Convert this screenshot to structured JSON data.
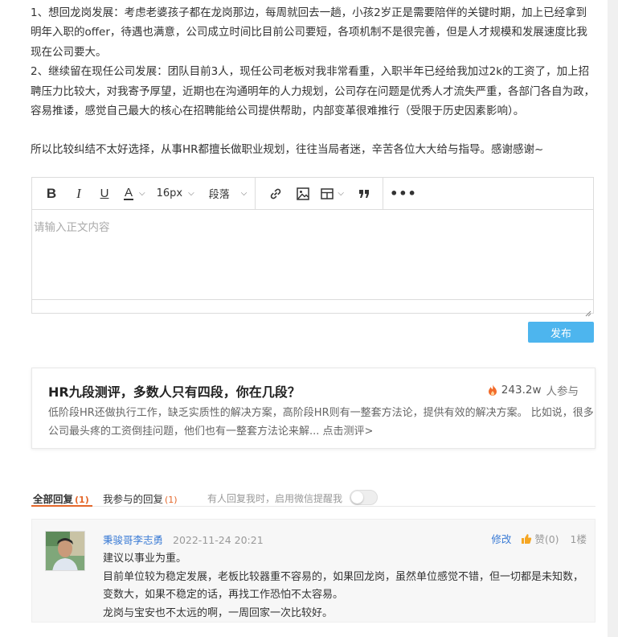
{
  "post": {
    "paragraphs": [
      "1、想回龙岗发展：考虑老婆孩子都在龙岗那边，每周就回去一趟，小孩2岁正是需要陪伴的关键时期，加上已经拿到明年入职的offer，待遇也满意，公司成立时间比目前公司要短，各项机制不是很完善，但是人才规模和发展速度比我现在公司要大。",
      "2、继续留在现任公司发展：团队目前3人，现任公司老板对我非常看重，入职半年已经给我加过2k的工资了，加上招聘压力比较大，对我寄予厚望，近期也在沟通明年的人力规划，公司存在问题是优秀人才流失严重，各部门各自为政，容易推诿，感觉自己最大的核心在招聘能给公司提供帮助，内部变革很难推行（受限于历史因素影响）。",
      "所以比较纠结不太好选择，从事HR都擅长做职业规划，往往当局者迷，辛苦各位大大给与指导。感谢感谢~"
    ]
  },
  "editor": {
    "font_size": "16px",
    "paragraph_style": "段落",
    "placeholder": "请输入正文内容",
    "icons": [
      "bold-icon",
      "italic-icon",
      "underline-icon",
      "font-color-icon",
      "link-icon",
      "image-icon",
      "table-icon",
      "quote-icon",
      "more-icon"
    ]
  },
  "publish_label": "发布",
  "promo": {
    "title": "HR九段测评，多数人只有四段，你在几段？",
    "count": "243.2w",
    "count_label": "人参与",
    "description": "低阶段HR还做执行工作，缺乏实质性的解决方案，高阶段HR则有一整套方法论，提供有效的解决方案。 比如说，很多公司最头疼的工资倒挂问题，他们也有一整套方法论来解... 点击测评>"
  },
  "tabs": {
    "all_label": "全部回复",
    "all_count": "(1)",
    "mine_label": "我参与的回复",
    "mine_count": "(1)",
    "notify_text": "有人回复我时，启用微信提醒我"
  },
  "reply": {
    "author": "秉骏哥李志勇",
    "time": "2022-11-24 20:21",
    "edit_label": "修改",
    "like_label": "赞(0)",
    "floor": "1楼",
    "lines": [
      "建议以事业为重。",
      "目前单位较为稳定发展，老板比较器重不容易的，如果回龙岗，虽然单位感觉不错，但一切都是未知数，变数大，如果不稳定的话，再找工作恐怕不太容易。",
      "龙岗与宝安也不太远的啊，一周回家一次比较好。"
    ]
  },
  "colors": {
    "accent_blue": "#4db5ee",
    "link_blue": "#3a7bd5",
    "tab_orange": "#e4672a",
    "hot_orange": "#f26b2a"
  }
}
